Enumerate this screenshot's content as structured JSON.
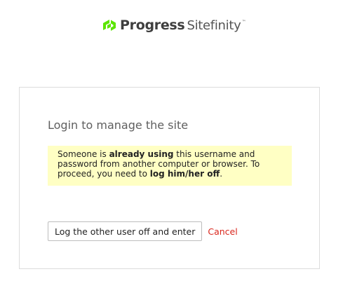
{
  "brand": {
    "name_bold": "Progress",
    "name_light": "Sitefinity",
    "trademark": "™",
    "accent_color": "#5ce500"
  },
  "login": {
    "title": "Login to manage the site",
    "notice": {
      "part1": "Someone is ",
      "bold1": "already using",
      "part2": " this username and password from another computer or browser. To proceed, you need to ",
      "bold2": "log him/her off",
      "part3": "."
    },
    "primary_button": "Log the other user off and enter",
    "cancel_link": "Cancel"
  }
}
